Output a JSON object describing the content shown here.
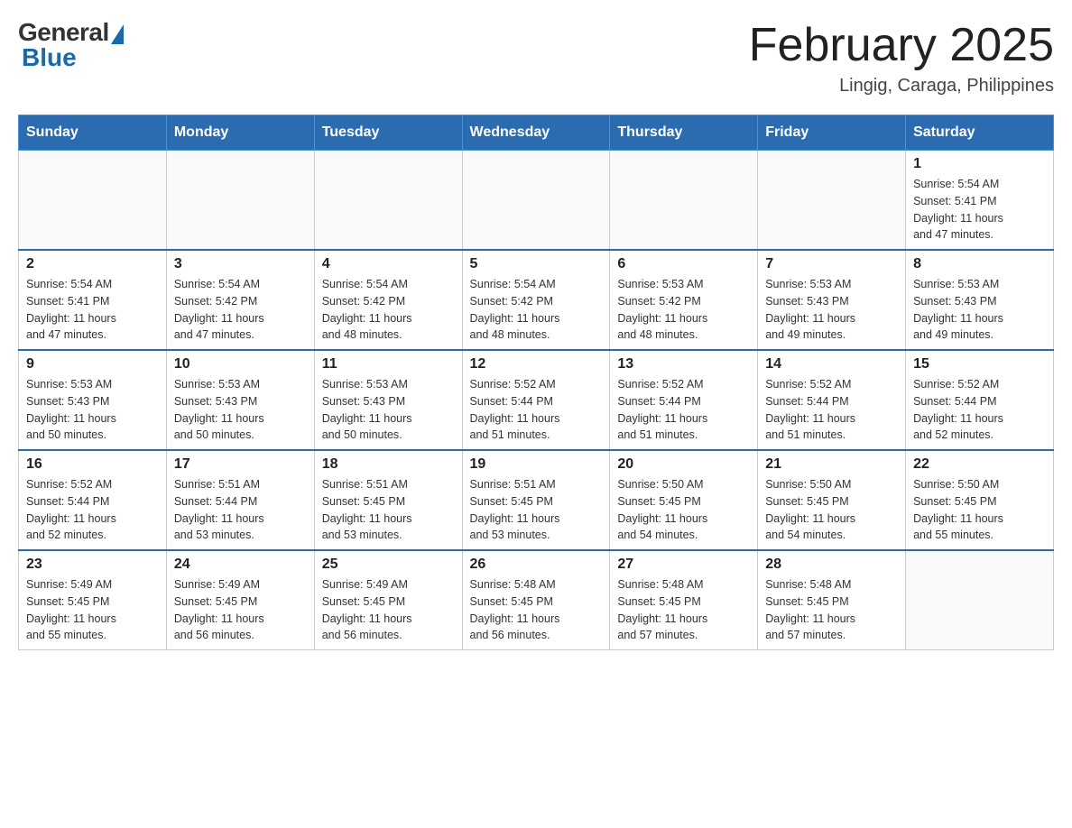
{
  "logo": {
    "general": "General",
    "blue": "Blue"
  },
  "title": "February 2025",
  "location": "Lingig, Caraga, Philippines",
  "days_of_week": [
    "Sunday",
    "Monday",
    "Tuesday",
    "Wednesday",
    "Thursday",
    "Friday",
    "Saturday"
  ],
  "weeks": [
    [
      {
        "day": "",
        "info": ""
      },
      {
        "day": "",
        "info": ""
      },
      {
        "day": "",
        "info": ""
      },
      {
        "day": "",
        "info": ""
      },
      {
        "day": "",
        "info": ""
      },
      {
        "day": "",
        "info": ""
      },
      {
        "day": "1",
        "info": "Sunrise: 5:54 AM\nSunset: 5:41 PM\nDaylight: 11 hours\nand 47 minutes."
      }
    ],
    [
      {
        "day": "2",
        "info": "Sunrise: 5:54 AM\nSunset: 5:41 PM\nDaylight: 11 hours\nand 47 minutes."
      },
      {
        "day": "3",
        "info": "Sunrise: 5:54 AM\nSunset: 5:42 PM\nDaylight: 11 hours\nand 47 minutes."
      },
      {
        "day": "4",
        "info": "Sunrise: 5:54 AM\nSunset: 5:42 PM\nDaylight: 11 hours\nand 48 minutes."
      },
      {
        "day": "5",
        "info": "Sunrise: 5:54 AM\nSunset: 5:42 PM\nDaylight: 11 hours\nand 48 minutes."
      },
      {
        "day": "6",
        "info": "Sunrise: 5:53 AM\nSunset: 5:42 PM\nDaylight: 11 hours\nand 48 minutes."
      },
      {
        "day": "7",
        "info": "Sunrise: 5:53 AM\nSunset: 5:43 PM\nDaylight: 11 hours\nand 49 minutes."
      },
      {
        "day": "8",
        "info": "Sunrise: 5:53 AM\nSunset: 5:43 PM\nDaylight: 11 hours\nand 49 minutes."
      }
    ],
    [
      {
        "day": "9",
        "info": "Sunrise: 5:53 AM\nSunset: 5:43 PM\nDaylight: 11 hours\nand 50 minutes."
      },
      {
        "day": "10",
        "info": "Sunrise: 5:53 AM\nSunset: 5:43 PM\nDaylight: 11 hours\nand 50 minutes."
      },
      {
        "day": "11",
        "info": "Sunrise: 5:53 AM\nSunset: 5:43 PM\nDaylight: 11 hours\nand 50 minutes."
      },
      {
        "day": "12",
        "info": "Sunrise: 5:52 AM\nSunset: 5:44 PM\nDaylight: 11 hours\nand 51 minutes."
      },
      {
        "day": "13",
        "info": "Sunrise: 5:52 AM\nSunset: 5:44 PM\nDaylight: 11 hours\nand 51 minutes."
      },
      {
        "day": "14",
        "info": "Sunrise: 5:52 AM\nSunset: 5:44 PM\nDaylight: 11 hours\nand 51 minutes."
      },
      {
        "day": "15",
        "info": "Sunrise: 5:52 AM\nSunset: 5:44 PM\nDaylight: 11 hours\nand 52 minutes."
      }
    ],
    [
      {
        "day": "16",
        "info": "Sunrise: 5:52 AM\nSunset: 5:44 PM\nDaylight: 11 hours\nand 52 minutes."
      },
      {
        "day": "17",
        "info": "Sunrise: 5:51 AM\nSunset: 5:44 PM\nDaylight: 11 hours\nand 53 minutes."
      },
      {
        "day": "18",
        "info": "Sunrise: 5:51 AM\nSunset: 5:45 PM\nDaylight: 11 hours\nand 53 minutes."
      },
      {
        "day": "19",
        "info": "Sunrise: 5:51 AM\nSunset: 5:45 PM\nDaylight: 11 hours\nand 53 minutes."
      },
      {
        "day": "20",
        "info": "Sunrise: 5:50 AM\nSunset: 5:45 PM\nDaylight: 11 hours\nand 54 minutes."
      },
      {
        "day": "21",
        "info": "Sunrise: 5:50 AM\nSunset: 5:45 PM\nDaylight: 11 hours\nand 54 minutes."
      },
      {
        "day": "22",
        "info": "Sunrise: 5:50 AM\nSunset: 5:45 PM\nDaylight: 11 hours\nand 55 minutes."
      }
    ],
    [
      {
        "day": "23",
        "info": "Sunrise: 5:49 AM\nSunset: 5:45 PM\nDaylight: 11 hours\nand 55 minutes."
      },
      {
        "day": "24",
        "info": "Sunrise: 5:49 AM\nSunset: 5:45 PM\nDaylight: 11 hours\nand 56 minutes."
      },
      {
        "day": "25",
        "info": "Sunrise: 5:49 AM\nSunset: 5:45 PM\nDaylight: 11 hours\nand 56 minutes."
      },
      {
        "day": "26",
        "info": "Sunrise: 5:48 AM\nSunset: 5:45 PM\nDaylight: 11 hours\nand 56 minutes."
      },
      {
        "day": "27",
        "info": "Sunrise: 5:48 AM\nSunset: 5:45 PM\nDaylight: 11 hours\nand 57 minutes."
      },
      {
        "day": "28",
        "info": "Sunrise: 5:48 AM\nSunset: 5:45 PM\nDaylight: 11 hours\nand 57 minutes."
      },
      {
        "day": "",
        "info": ""
      }
    ]
  ]
}
